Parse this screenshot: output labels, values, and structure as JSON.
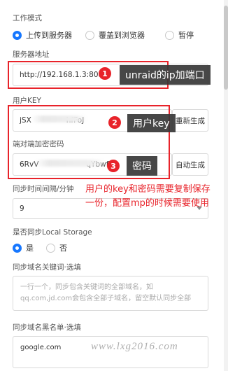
{
  "sync_mode": {
    "label": "工作模式",
    "options": [
      {
        "label": "上传到服务器",
        "selected": true
      },
      {
        "label": "覆盖到浏览器",
        "selected": false
      },
      {
        "label": "暂停",
        "selected": false
      }
    ]
  },
  "server_address": {
    "label": "服务器地址",
    "value": "http://192.168.1.3:8088",
    "callout_number": "1",
    "callout_text": "unraid的ip加端口"
  },
  "user_key": {
    "label": "用户KEY",
    "value_start": "jSX",
    "value_end": "hfFoJ",
    "regenerate_button": "重新生成",
    "callout_number": "2",
    "callout_text": "用户key"
  },
  "encryption_key": {
    "label": "端对端加密密码",
    "value_start": "6RvV",
    "value_end": "qYbwfV",
    "autogen_button": "自动生成",
    "callout_number": "3",
    "callout_text": "密码"
  },
  "note": "用户的key和密码需要复制保存一份，配置mp的时候需要使用",
  "sync_interval": {
    "label": "同步时间间隔/分钟",
    "value": "9"
  },
  "local_storage": {
    "label": "是否同步Local Storage",
    "options": [
      {
        "label": "是",
        "selected": true
      },
      {
        "label": "否",
        "selected": false
      }
    ]
  },
  "domain_keywords": {
    "label": "同步域名关键词·选填",
    "placeholder": "一行一个，同步包含关键词的全部域名，如qq.com,jd.com会包含全部子域名，留空默认同步全部"
  },
  "domain_blacklist": {
    "label": "同步域名黑名单·选填",
    "value": "google.com"
  },
  "watermark": "www.lxg2016.com",
  "colors": {
    "accent": "#1677ff",
    "annotation_red": "#e8232a",
    "tooltip_bg": "#373737"
  }
}
